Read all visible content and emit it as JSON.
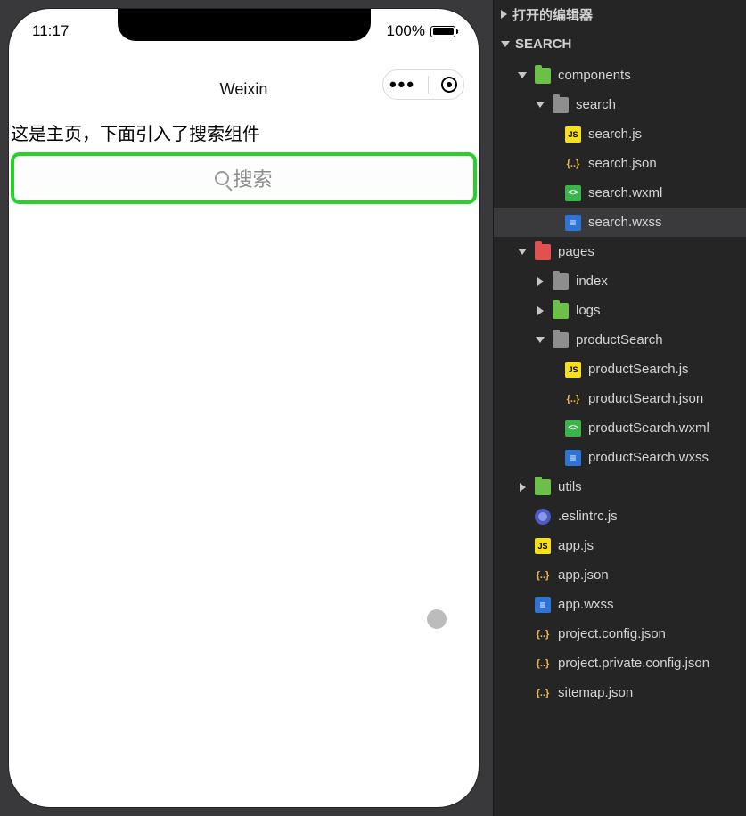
{
  "simulator": {
    "status": {
      "time": "11:17",
      "battery_pct": "100%"
    },
    "nav_title": "Weixin",
    "page_heading": "这是主页，下面引入了搜索组件",
    "search_placeholder": "搜索"
  },
  "explorer": {
    "sections": {
      "open_editors": "打开的编辑器",
      "project": "SEARCH"
    },
    "tree": {
      "components": {
        "label": "components",
        "search": {
          "label": "search",
          "files": {
            "js": "search.js",
            "json": "search.json",
            "wxml": "search.wxml",
            "wxss": "search.wxss"
          }
        }
      },
      "pages": {
        "label": "pages",
        "index": "index",
        "logs": "logs",
        "productSearch": {
          "label": "productSearch",
          "files": {
            "js": "productSearch.js",
            "json": "productSearch.json",
            "wxml": "productSearch.wxml",
            "wxss": "productSearch.wxss"
          }
        }
      },
      "utils": "utils",
      "root_files": {
        "eslint": ".eslintrc.js",
        "appjs": "app.js",
        "appjson": "app.json",
        "appwxss": "app.wxss",
        "projcfg": "project.config.json",
        "projpriv": "project.private.config.json",
        "sitemap": "sitemap.json"
      }
    },
    "selected_file_path": "components/search/search.wxss"
  }
}
